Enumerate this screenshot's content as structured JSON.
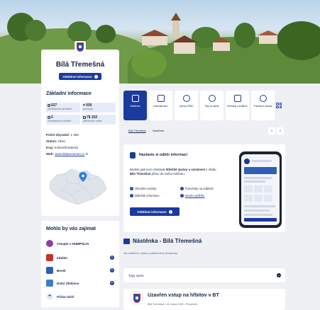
{
  "profile": {
    "name": "Bílá Třemešná",
    "subscribe_label": "Odebírat informace"
  },
  "basic_info": {
    "title": "Základní informace",
    "stats": [
      {
        "value": "527",
        "label": "přihlášeným uživatelů",
        "icon": "user-icon"
      },
      {
        "value": "939",
        "label": "pochvaly",
        "icon": "heart-icon"
      },
      {
        "value": "0",
        "label": "nahlášených podnětů",
        "icon": "person-icon"
      },
      {
        "value": "78 252",
        "label": "přečtených zpráv",
        "icon": "message-icon"
      }
    ],
    "population_label": "Počet obyvatel:",
    "population_value": "1 353",
    "status_label": "Status:",
    "status_value": "Obec",
    "region_label": "Kraj:",
    "region_value": "Královéhradecký",
    "web_label": "Web:",
    "web_value": "www.bilatremesna.cz"
  },
  "interest": {
    "title": "Mohlo by vás zajímat",
    "items": [
      {
        "label": "Vstupte s HUMPOLIS",
        "color": "#8a3fa6"
      },
      {
        "label": "Zdobín",
        "color": "#c9302c"
      },
      {
        "label": "Borek",
        "color": "#2f5fb8"
      },
      {
        "label": "Dolní Olešnice",
        "color": "#3a7fc9"
      },
      {
        "label": "Přidat další",
        "color": "#1a3a9e"
      }
    ]
  },
  "tiles": [
    {
      "label": "Nástěnka",
      "icon": "board-icon"
    },
    {
      "label": "Kalendář akcí",
      "icon": "calendar-icon"
    },
    {
      "label": "Vývozy ČMKI",
      "icon": "bin-icon"
    },
    {
      "label": "Tipy na výlety",
      "icon": "compass-icon"
    },
    {
      "label": "Kontakty a instituce",
      "icon": "phone-icon"
    },
    {
      "label": "Podněty a závady",
      "icon": "pin-icon"
    }
  ],
  "breadcrumb": {
    "home": "Bílá Třemešná",
    "current": "Nástěnka"
  },
  "subscribe_box": {
    "title": "Nastavte si odběr informací",
    "text_1": "Budete pak moci dostávat ",
    "text_bold_1": "důležité zprávy a oznámení",
    "text_2": " z úřadu ",
    "text_bold_2": "Bílá Třemešná",
    "text_3": " přímo do svého telefonu.",
    "options": [
      "Oficiální novinky",
      "Pozvánky na události",
      "Důležité informace",
      "Mnoho dalšího"
    ],
    "button_label": "Odebírat informace"
  },
  "board": {
    "title": "Nástěnka - Bílá Třemešná",
    "empty": "Na nástěnce nejsou publikované příspěvky.",
    "types_label": "Typy zpráv"
  },
  "article": {
    "title": "Uzavřen vstup na hřbitov v BT",
    "meta": "Bílá Třemešná  •  16. ledna 2026  •  Příspěvek"
  },
  "colors": {
    "accent": "#1a3a9e",
    "dark": "#152447"
  }
}
